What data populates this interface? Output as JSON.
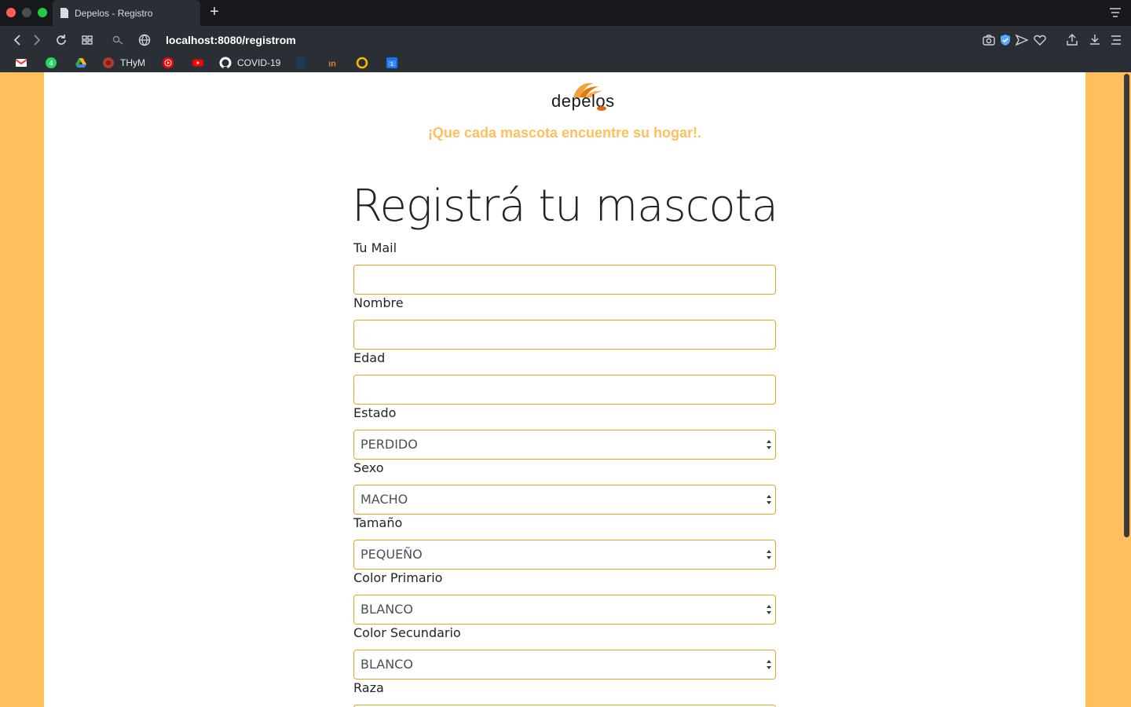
{
  "browser": {
    "tab_title": "Depelos - Registro",
    "url": "localhost:8080/registrom",
    "bookmarks": [
      {
        "label": "",
        "icon": "gmail-icon",
        "color": "#e94235"
      },
      {
        "label": "",
        "icon": "whatsapp-icon",
        "color": "#25d366"
      },
      {
        "label": "",
        "icon": "google-drive-icon",
        "color": "#fbbc04"
      },
      {
        "label": "THyM",
        "icon": "thym-icon",
        "color": "#b03a2e"
      },
      {
        "label": "",
        "icon": "youtube-music-icon",
        "color": "#ff0000"
      },
      {
        "label": "",
        "icon": "youtube-icon",
        "color": "#ff0000"
      },
      {
        "label": "COVID-19",
        "icon": "github-icon",
        "color": "#ffffff"
      },
      {
        "label": "",
        "icon": "bookmark-dark-icon",
        "color": "#1c3b57"
      },
      {
        "label": "",
        "icon": "in-icon",
        "color": "#e7812e"
      },
      {
        "label": "",
        "icon": "ring-icon",
        "color": "#f5b800"
      },
      {
        "label": "",
        "icon": "calendar-icon",
        "color": "#1a73e8"
      }
    ]
  },
  "page": {
    "logo_text": "depelos",
    "tagline": "¡Que cada mascota encuentre su hogar!.",
    "heading": "Registrá tu mascota",
    "accent_color": "#ffbf5c",
    "fields": {
      "mail": {
        "label": "Tu Mail",
        "value": ""
      },
      "nombre": {
        "label": "Nombre",
        "value": ""
      },
      "edad": {
        "label": "Edad",
        "value": ""
      },
      "estado": {
        "label": "Estado",
        "value": "PERDIDO"
      },
      "sexo": {
        "label": "Sexo",
        "value": "MACHO"
      },
      "tamano": {
        "label": "Tamaño",
        "value": "PEQUEÑO"
      },
      "color_primario": {
        "label": "Color Primario",
        "value": "BLANCO"
      },
      "color_secundario": {
        "label": "Color Secundario",
        "value": "BLANCO"
      },
      "raza": {
        "label": "Raza",
        "value": ""
      }
    }
  }
}
